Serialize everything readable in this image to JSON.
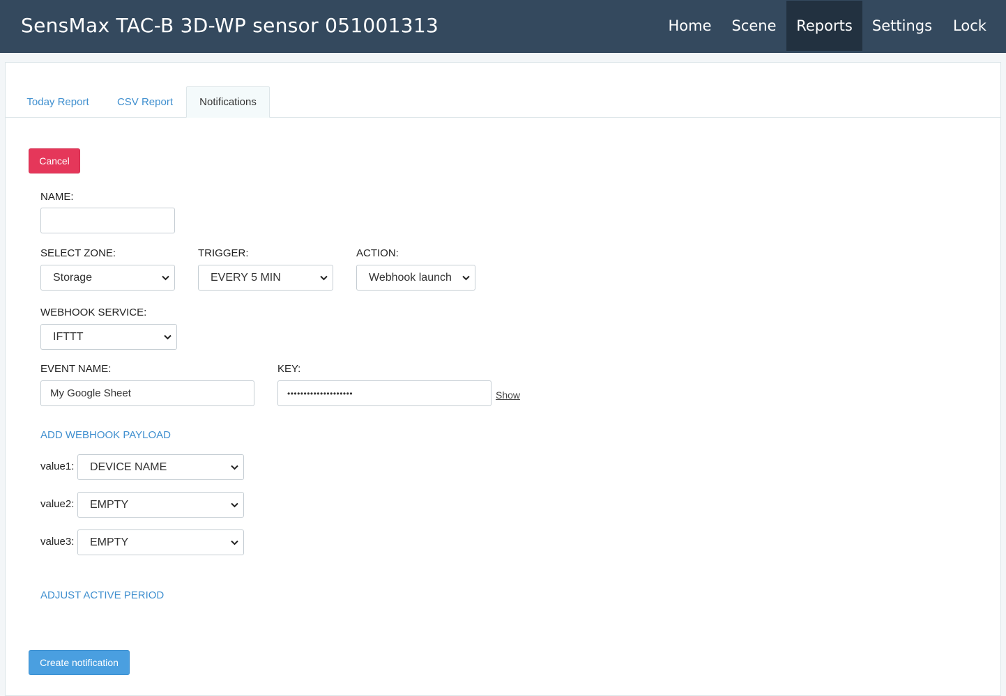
{
  "app": {
    "title": "SensMax TAC-B 3D-WP sensor 051001313"
  },
  "nav": {
    "home": "Home",
    "scene": "Scene",
    "reports": "Reports",
    "settings": "Settings",
    "lock": "Lock",
    "active": "Reports"
  },
  "tabs": {
    "today": "Today Report",
    "csv": "CSV Report",
    "notifications": "Notifications",
    "active": "Notifications"
  },
  "form": {
    "cancel_label": "Cancel",
    "name_label": "NAME:",
    "name_value": "",
    "zone_label": "SELECT ZONE:",
    "zone_value": "Storage",
    "trigger_label": "TRIGGER:",
    "trigger_value": "EVERY 5 MIN",
    "action_label": "ACTION:",
    "action_value": "Webhook launch",
    "webhook_service_label": "WEBHOOK SERVICE:",
    "webhook_service_value": "IFTTT",
    "event_name_label": "EVENT NAME:",
    "event_name_value": "My Google Sheet",
    "key_label": "KEY:",
    "key_value": "••••••••••••••••••••",
    "show_label": "Show",
    "add_payload_label": "ADD WEBHOOK PAYLOAD",
    "payload": [
      {
        "label": "value1:",
        "value": "DEVICE NAME"
      },
      {
        "label": "value2:",
        "value": "EMPTY"
      },
      {
        "label": "value3:",
        "value": "EMPTY"
      }
    ],
    "adjust_period_label": "ADJUST ACTIVE PERIOD",
    "create_label": "Create notification"
  },
  "colors": {
    "navbar": "#34495e",
    "navbar_active": "#223140",
    "cancel": "#e5375a",
    "create": "#4a9fe0",
    "link": "#3f8fcf"
  }
}
